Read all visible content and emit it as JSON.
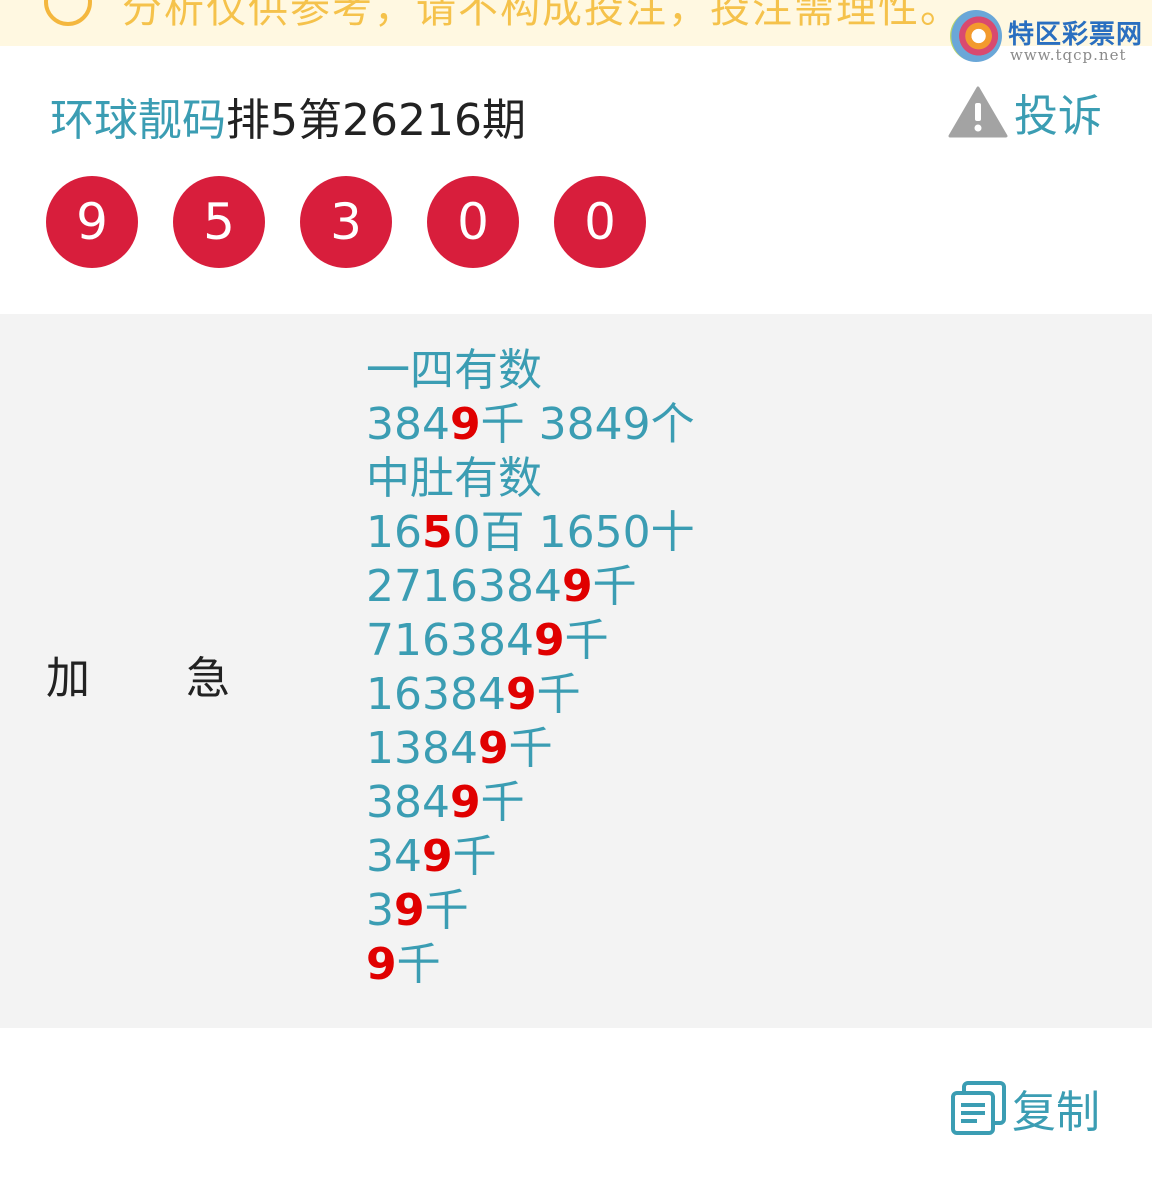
{
  "notice": {
    "text": "分析仅供参考，请不构成投注，投注需理性。"
  },
  "logo": {
    "name": "特区彩票网",
    "url": "www.tqcp.net"
  },
  "header": {
    "author": "环球靓码",
    "issue": "排5第26216期",
    "complain_label": "投诉"
  },
  "result_numbers": [
    "9",
    "5",
    "3",
    "0",
    "0"
  ],
  "post": {
    "label_left": "加",
    "label_right": "急",
    "lines": [
      {
        "pre": "一四有数",
        "hl": "",
        "post": ""
      },
      {
        "pre": "384",
        "hl": "9",
        "post": "千 3849个"
      },
      {
        "pre": "中肚有数",
        "hl": "",
        "post": ""
      },
      {
        "pre": "16",
        "hl": "5",
        "post": "0百 1650十"
      },
      {
        "pre": "2716384",
        "hl": "9",
        "post": "千"
      },
      {
        "pre": "716384",
        "hl": "9",
        "post": "千"
      },
      {
        "pre": "16384",
        "hl": "9",
        "post": "千"
      },
      {
        "pre": "1384",
        "hl": "9",
        "post": "千"
      },
      {
        "pre": "384",
        "hl": "9",
        "post": "千"
      },
      {
        "pre": "34",
        "hl": "9",
        "post": "千"
      },
      {
        "pre": "3",
        "hl": "9",
        "post": "千"
      },
      {
        "pre": "",
        "hl": "9",
        "post": "千"
      }
    ]
  },
  "footer": {
    "copy_label": "复制"
  },
  "colors": {
    "accent": "#3b9db3",
    "ball": "#d81e3c",
    "highlight": "#e00000",
    "content_bg": "#f3f3f3",
    "notice_bg": "#fff8e1"
  }
}
